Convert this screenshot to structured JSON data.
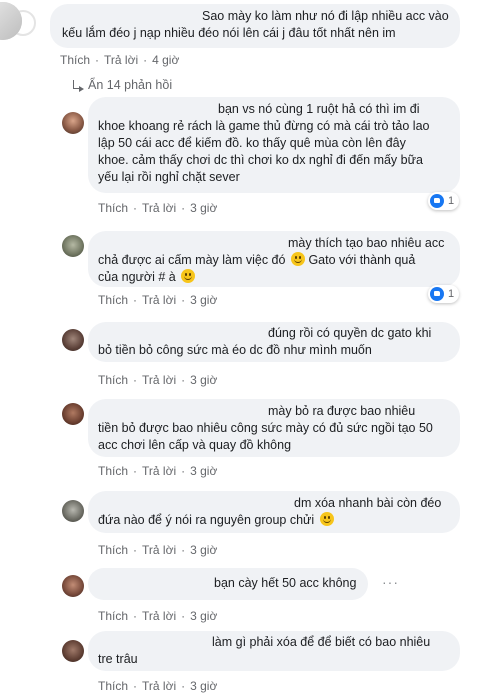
{
  "colors": {
    "bubble_bg": "#f0f2f5",
    "meta_text": "#65676b",
    "like_blue": "#1877f2",
    "emoji_yellow": "#f7c51a"
  },
  "top_comment": {
    "line1": "Sao mày ko làm như nó đi lập nhiều acc vào",
    "line2": "kếu lắm đéo j nạp nhiều đéo nói lên cái j đâu tốt nhất nên im",
    "actions": {
      "like": "Thích",
      "reply": "Trả lời",
      "dot": "·",
      "time": "4 giờ"
    }
  },
  "replies_toggle": {
    "icon": "reply-arrow-icon",
    "label": "Ẩn 14 phản hồi"
  },
  "replies": [
    {
      "lines": [
        "bạn vs nó cùng 1 ruột hả có thì im đi",
        "khoe khoang rẻ rách là game thủ đừng có mà cái trò tảo lao",
        "lập 50 cái acc để kiếm đồ. ko thấy quê mùa còn lên đây",
        "khoe. cảm thấy chơi dc thì chơi ko dx nghỉ đi đến mấy bữa",
        "yếu lại rồi nghỉ chặt sever"
      ],
      "actions": {
        "like": "Thích",
        "reply": "Trả lời",
        "dot": "·",
        "time": "3 giờ"
      },
      "likes": "1"
    },
    {
      "lines": [
        "mày thích tạo bao nhiêu acc",
        "chả được ai cấm mày làm việc đó",
        "Gato với thành quả",
        "của người # à"
      ],
      "actions": {
        "like": "Thích",
        "reply": "Trả lời",
        "dot": "·",
        "time": "3 giờ"
      },
      "likes": "1"
    },
    {
      "lines": [
        "đúng rồi có quyền dc gato khi",
        "bỏ tiền bỏ công sức mà éo dc đồ như mình muốn"
      ],
      "actions": {
        "like": "Thích",
        "reply": "Trả lời",
        "dot": "·",
        "time": "3 giờ"
      }
    },
    {
      "lines": [
        "mày bỏ ra được bao nhiêu",
        "tiền bỏ được bao nhiêu công sức mày có đủ sức ngồi tạo 50",
        "acc chơi lên cấp và quay đồ không"
      ],
      "actions": {
        "like": "Thích",
        "reply": "Trả lời",
        "dot": "·",
        "time": "3 giờ"
      }
    },
    {
      "lines": [
        "dm xóa nhanh bài còn đéo",
        "đứa nào để ý nói ra nguyên group chửi"
      ],
      "actions": {
        "like": "Thích",
        "reply": "Trả lời",
        "dot": "·",
        "time": "3 giờ"
      }
    },
    {
      "lines": [
        "bạn cày hết 50 acc không"
      ],
      "actions": {
        "like": "Thích",
        "reply": "Trả lời",
        "dot": "·",
        "time": "3 giờ"
      },
      "more": "···"
    },
    {
      "lines": [
        "làm gì phải xóa để để biết có bao nhiêu",
        "tre trâu"
      ],
      "actions": {
        "like": "Thích",
        "reply": "Trả lời",
        "dot": "·",
        "time": "3 giờ"
      }
    }
  ]
}
